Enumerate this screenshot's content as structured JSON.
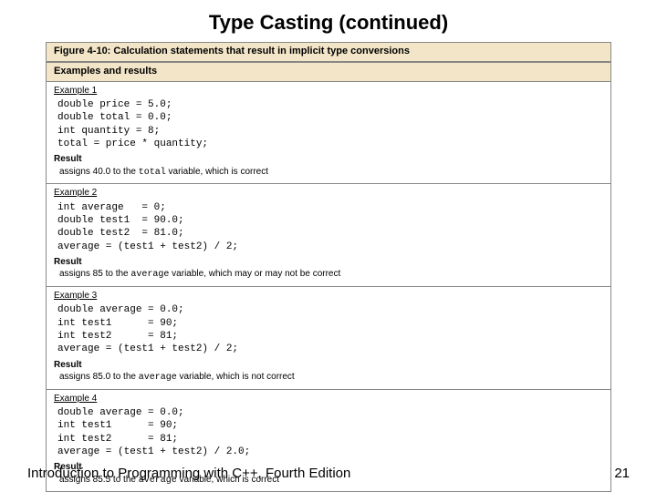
{
  "title": "Type Casting (continued)",
  "figure_caption": "Figure 4-10: Calculation statements that result in implicit type conversions",
  "section_header": "Examples and results",
  "result_label": "Result",
  "examples": [
    {
      "label": "Example 1",
      "code": "double price = 5.0;\ndouble total = 0.0;\nint quantity = 8;\ntotal = price * quantity;",
      "result_prefix": "assigns 40.0 to the ",
      "result_var": "total",
      "result_suffix": " variable, which is correct"
    },
    {
      "label": "Example 2",
      "code": "int average   = 0;\ndouble test1  = 90.0;\ndouble test2  = 81.0;\naverage = (test1 + test2) / 2;",
      "result_prefix": "assigns 85 to the ",
      "result_var": "average",
      "result_suffix": " variable, which may or may not be correct"
    },
    {
      "label": "Example 3",
      "code": "double average = 0.0;\nint test1      = 90;\nint test2      = 81;\naverage = (test1 + test2) / 2;",
      "result_prefix": "assigns 85.0 to the ",
      "result_var": "average",
      "result_suffix": " variable, which is not correct"
    },
    {
      "label": "Example 4",
      "code": "double average = 0.0;\nint test1      = 90;\nint test2      = 81;\naverage = (test1 + test2) / 2.0;",
      "result_prefix": "assigns 85.5 to the ",
      "result_var": "average",
      "result_suffix": " variable, which is correct"
    }
  ],
  "footer_left": "Introduction to Programming with C++, Fourth Edition",
  "footer_right": "21"
}
